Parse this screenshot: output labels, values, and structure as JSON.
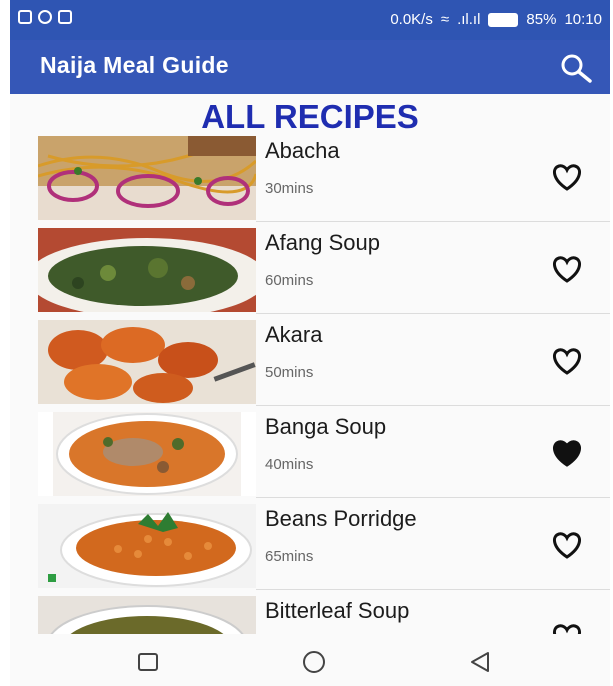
{
  "status_bar": {
    "network_speed": "0.0K/s",
    "battery": "85%",
    "time": "10:10"
  },
  "app_bar": {
    "title": "Naija Meal Guide",
    "search_icon": "search-icon"
  },
  "heading": "ALL RECIPES",
  "recipes": [
    {
      "name": "Abacha",
      "time": "30mins",
      "favorite": false
    },
    {
      "name": "Afang Soup",
      "time": "60mins",
      "favorite": false
    },
    {
      "name": "Akara",
      "time": "50mins",
      "favorite": false
    },
    {
      "name": "Banga Soup",
      "time": "40mins",
      "favorite": true
    },
    {
      "name": "Beans Porridge",
      "time": "65mins",
      "favorite": false
    },
    {
      "name": "Bitterleaf Soup",
      "time": "",
      "favorite": false
    }
  ],
  "nav": {
    "icons": [
      "recent-apps-icon",
      "home-icon",
      "back-icon"
    ]
  },
  "colors": {
    "primary": "#3557b7",
    "heading": "#1f2db0"
  }
}
